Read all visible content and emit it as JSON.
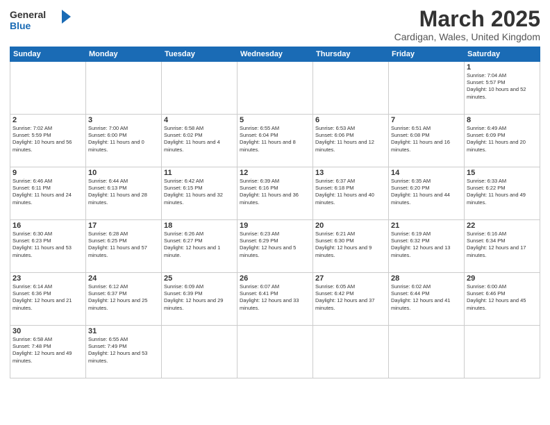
{
  "header": {
    "logo_general": "General",
    "logo_blue": "Blue",
    "month_title": "March 2025",
    "subtitle": "Cardigan, Wales, United Kingdom"
  },
  "weekdays": [
    "Sunday",
    "Monday",
    "Tuesday",
    "Wednesday",
    "Thursday",
    "Friday",
    "Saturday"
  ],
  "days": {
    "d1": {
      "num": "1",
      "sunrise": "7:04 AM",
      "sunset": "5:57 PM",
      "daylight": "10 hours and 52 minutes."
    },
    "d2": {
      "num": "2",
      "sunrise": "7:02 AM",
      "sunset": "5:59 PM",
      "daylight": "10 hours and 56 minutes."
    },
    "d3": {
      "num": "3",
      "sunrise": "7:00 AM",
      "sunset": "6:00 PM",
      "daylight": "11 hours and 0 minutes."
    },
    "d4": {
      "num": "4",
      "sunrise": "6:58 AM",
      "sunset": "6:02 PM",
      "daylight": "11 hours and 4 minutes."
    },
    "d5": {
      "num": "5",
      "sunrise": "6:55 AM",
      "sunset": "6:04 PM",
      "daylight": "11 hours and 8 minutes."
    },
    "d6": {
      "num": "6",
      "sunrise": "6:53 AM",
      "sunset": "6:06 PM",
      "daylight": "11 hours and 12 minutes."
    },
    "d7": {
      "num": "7",
      "sunrise": "6:51 AM",
      "sunset": "6:08 PM",
      "daylight": "11 hours and 16 minutes."
    },
    "d8": {
      "num": "8",
      "sunrise": "6:49 AM",
      "sunset": "6:09 PM",
      "daylight": "11 hours and 20 minutes."
    },
    "d9": {
      "num": "9",
      "sunrise": "6:46 AM",
      "sunset": "6:11 PM",
      "daylight": "11 hours and 24 minutes."
    },
    "d10": {
      "num": "10",
      "sunrise": "6:44 AM",
      "sunset": "6:13 PM",
      "daylight": "11 hours and 28 minutes."
    },
    "d11": {
      "num": "11",
      "sunrise": "6:42 AM",
      "sunset": "6:15 PM",
      "daylight": "11 hours and 32 minutes."
    },
    "d12": {
      "num": "12",
      "sunrise": "6:39 AM",
      "sunset": "6:16 PM",
      "daylight": "11 hours and 36 minutes."
    },
    "d13": {
      "num": "13",
      "sunrise": "6:37 AM",
      "sunset": "6:18 PM",
      "daylight": "11 hours and 40 minutes."
    },
    "d14": {
      "num": "14",
      "sunrise": "6:35 AM",
      "sunset": "6:20 PM",
      "daylight": "11 hours and 44 minutes."
    },
    "d15": {
      "num": "15",
      "sunrise": "6:33 AM",
      "sunset": "6:22 PM",
      "daylight": "11 hours and 49 minutes."
    },
    "d16": {
      "num": "16",
      "sunrise": "6:30 AM",
      "sunset": "6:23 PM",
      "daylight": "11 hours and 53 minutes."
    },
    "d17": {
      "num": "17",
      "sunrise": "6:28 AM",
      "sunset": "6:25 PM",
      "daylight": "11 hours and 57 minutes."
    },
    "d18": {
      "num": "18",
      "sunrise": "6:26 AM",
      "sunset": "6:27 PM",
      "daylight": "12 hours and 1 minute."
    },
    "d19": {
      "num": "19",
      "sunrise": "6:23 AM",
      "sunset": "6:29 PM",
      "daylight": "12 hours and 5 minutes."
    },
    "d20": {
      "num": "20",
      "sunrise": "6:21 AM",
      "sunset": "6:30 PM",
      "daylight": "12 hours and 9 minutes."
    },
    "d21": {
      "num": "21",
      "sunrise": "6:19 AM",
      "sunset": "6:32 PM",
      "daylight": "12 hours and 13 minutes."
    },
    "d22": {
      "num": "22",
      "sunrise": "6:16 AM",
      "sunset": "6:34 PM",
      "daylight": "12 hours and 17 minutes."
    },
    "d23": {
      "num": "23",
      "sunrise": "6:14 AM",
      "sunset": "6:36 PM",
      "daylight": "12 hours and 21 minutes."
    },
    "d24": {
      "num": "24",
      "sunrise": "6:12 AM",
      "sunset": "6:37 PM",
      "daylight": "12 hours and 25 minutes."
    },
    "d25": {
      "num": "25",
      "sunrise": "6:09 AM",
      "sunset": "6:39 PM",
      "daylight": "12 hours and 29 minutes."
    },
    "d26": {
      "num": "26",
      "sunrise": "6:07 AM",
      "sunset": "6:41 PM",
      "daylight": "12 hours and 33 minutes."
    },
    "d27": {
      "num": "27",
      "sunrise": "6:05 AM",
      "sunset": "6:42 PM",
      "daylight": "12 hours and 37 minutes."
    },
    "d28": {
      "num": "28",
      "sunrise": "6:02 AM",
      "sunset": "6:44 PM",
      "daylight": "12 hours and 41 minutes."
    },
    "d29": {
      "num": "29",
      "sunrise": "6:00 AM",
      "sunset": "6:46 PM",
      "daylight": "12 hours and 45 minutes."
    },
    "d30": {
      "num": "30",
      "sunrise": "6:58 AM",
      "sunset": "7:48 PM",
      "daylight": "12 hours and 49 minutes."
    },
    "d31": {
      "num": "31",
      "sunrise": "6:55 AM",
      "sunset": "7:49 PM",
      "daylight": "12 hours and 53 minutes."
    }
  }
}
